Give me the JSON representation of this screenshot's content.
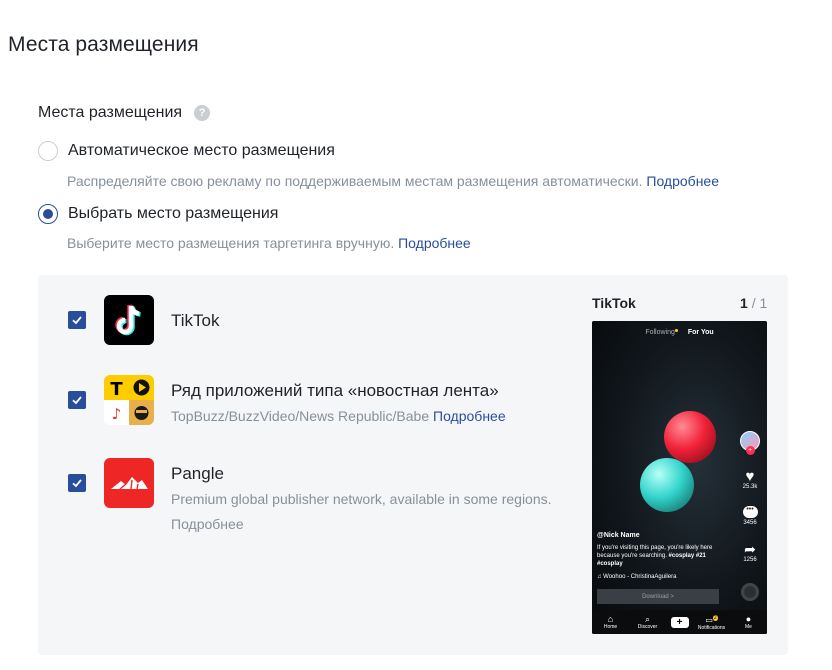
{
  "page_title": "Места размещения",
  "section_label": "Места размещения",
  "auto_option": {
    "label": "Автоматическое место размещения",
    "desc": "Распределяйте свою рекламу по поддерживаемым местам размещения автоматически.",
    "link": "Подробнее",
    "selected": false
  },
  "manual_option": {
    "label": "Выбрать место размещения",
    "desc": "Выберите место размещения таргетинга вручную.",
    "link": "Подробнее",
    "selected": true
  },
  "placements": [
    {
      "name": "TikTok",
      "checked": true,
      "icon": "tiktok-icon"
    },
    {
      "name": "Ряд приложений типа «новостная лента»",
      "desc": "TopBuzz/BuzzVideo/News Republic/Babe",
      "link": "Подробнее",
      "checked": true,
      "icon": "news-feed-apps-icon"
    },
    {
      "name": "Pangle",
      "desc": "Premium global publisher network, available in some regions.",
      "link": "Подробнее",
      "checked": true,
      "icon": "pangle-icon"
    }
  ],
  "preview": {
    "title": "TikTok",
    "page_current": "1",
    "page_total": "/ 1",
    "tabs": {
      "following": "Following",
      "for_you": "For You"
    },
    "username": "@Nick Name",
    "caption": "If you're visiting this page, you're likely here because you're searching.",
    "hashtags": "#cosplay #21 #cosplay",
    "music": "♫ Woohoo - ChristinaAguilera",
    "likes": "25.3k",
    "comments": "3456",
    "shares": "1256",
    "download": "Download >",
    "nav": {
      "home": "Home",
      "discover": "Discover",
      "notifications": "Notifications",
      "me": "Me"
    },
    "notification_badge": "2"
  },
  "colors": {
    "accent": "#2a4d9b",
    "panel_bg": "#f5f6f7",
    "muted": "#86909c"
  }
}
